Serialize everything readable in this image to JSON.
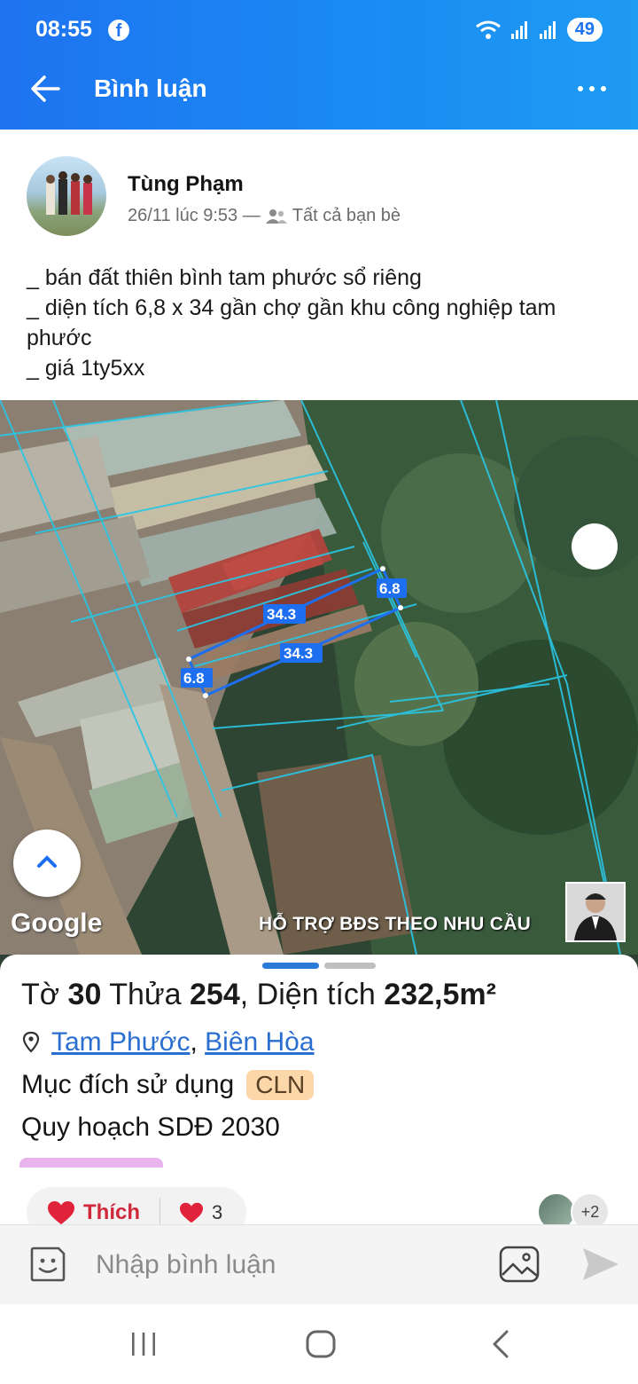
{
  "status_bar": {
    "time": "08:55",
    "battery": "49"
  },
  "header": {
    "title": "Bình luận"
  },
  "post": {
    "author": "Tùng Phạm",
    "timestamp": "26/11 lúc 9:53 —",
    "audience": "Tất cả bạn bè",
    "lines": [
      "_ bán đất thiên bình tam phước sổ riêng",
      "_ diện tích 6,8 x 34 gần chợ gần khu công nghiệp tam phước",
      "_ giá 1ty5xx"
    ]
  },
  "image": {
    "measurements": [
      "6.8",
      "34.3",
      "34.3",
      "6.8"
    ],
    "google_label": "Google",
    "watermark": "HỖ TRỢ BĐS  THEO NHU CẦU",
    "card": {
      "to_label": "Tờ",
      "to_value": "30",
      "thua_label": "Thửa",
      "thua_value": "254",
      "area_label": ", Diện tích",
      "area_value": "232,5m²",
      "ward": "Tam Phước",
      "city": "Biên Hòa",
      "purpose_label": "Mục đích sử dụng",
      "purpose_code": "CLN",
      "plan": "Quy hoạch SDĐ 2030"
    }
  },
  "reactions": {
    "like_label": "Thích",
    "count": "3",
    "others": "+2"
  },
  "comment": {
    "placeholder": "Nhập bình luận"
  },
  "colors": {
    "header": "#1e73f0",
    "heart": "#e0223a",
    "link": "#2a6ed0",
    "badge": "#fbd7a9"
  }
}
